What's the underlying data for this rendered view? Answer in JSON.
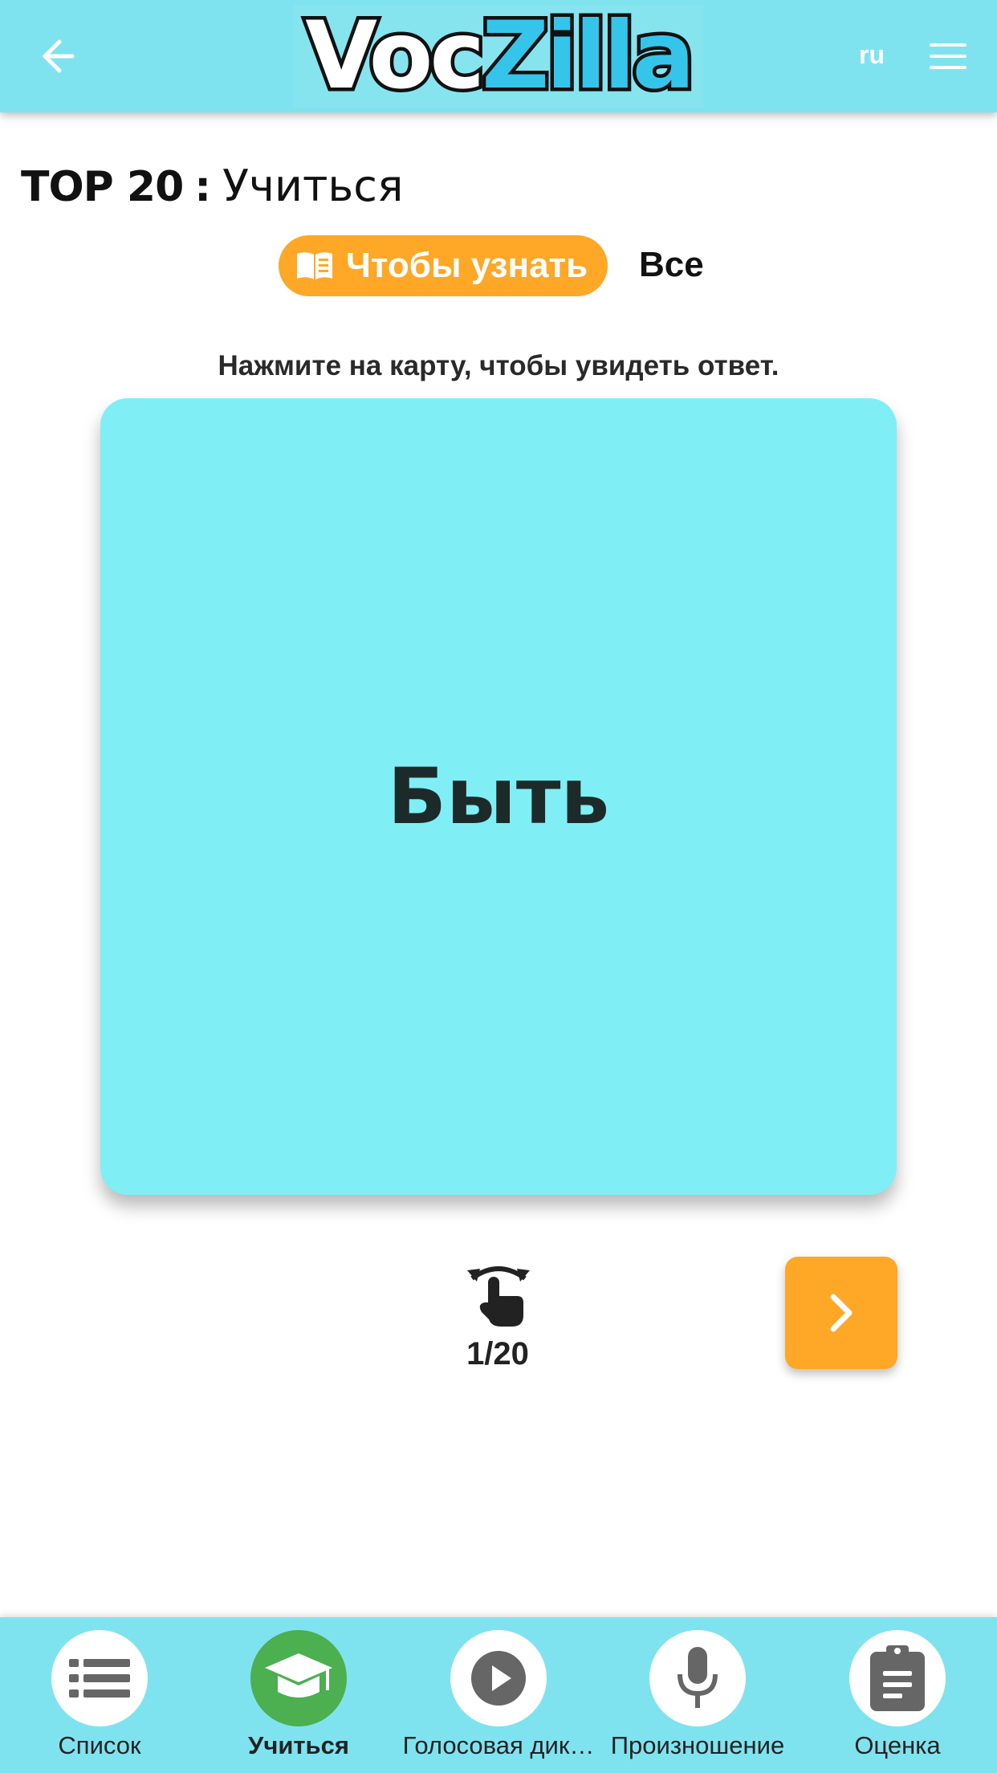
{
  "header": {
    "back_icon": "arrow-left-icon",
    "logo_part1": "Voc",
    "logo_part2": "Zilla",
    "language": "ru",
    "menu_icon": "hamburger-icon"
  },
  "title": {
    "strong": "TOP 20",
    "separator": ":",
    "mode": "Учиться"
  },
  "filters": {
    "learn_label": "Чтобы узнать",
    "learn_icon": "book-icon",
    "all_label": "Все",
    "active": "learn"
  },
  "instruction": "Нажмите на карту, чтобы увидеть ответ.",
  "card": {
    "word": "Быть",
    "color": "#80eef5"
  },
  "controls": {
    "flip_icon": "tap-flip-icon",
    "counter": "1/20",
    "next_icon": "chevron-right-icon"
  },
  "bottom_nav": {
    "items": [
      {
        "label": "Список",
        "icon": "list-icon",
        "active": false
      },
      {
        "label": "Учиться",
        "icon": "graduation-cap-icon",
        "active": true
      },
      {
        "label": "Голосовая дик…",
        "icon": "play-icon",
        "active": false
      },
      {
        "label": "Произношение",
        "icon": "microphone-icon",
        "active": false
      },
      {
        "label": "Оценка",
        "icon": "clipboard-icon",
        "active": false
      }
    ]
  },
  "colors": {
    "header_bg": "#7fe3ef",
    "accent_orange": "#ffa726",
    "active_green": "#4caf50",
    "icon_gray": "#666666"
  }
}
